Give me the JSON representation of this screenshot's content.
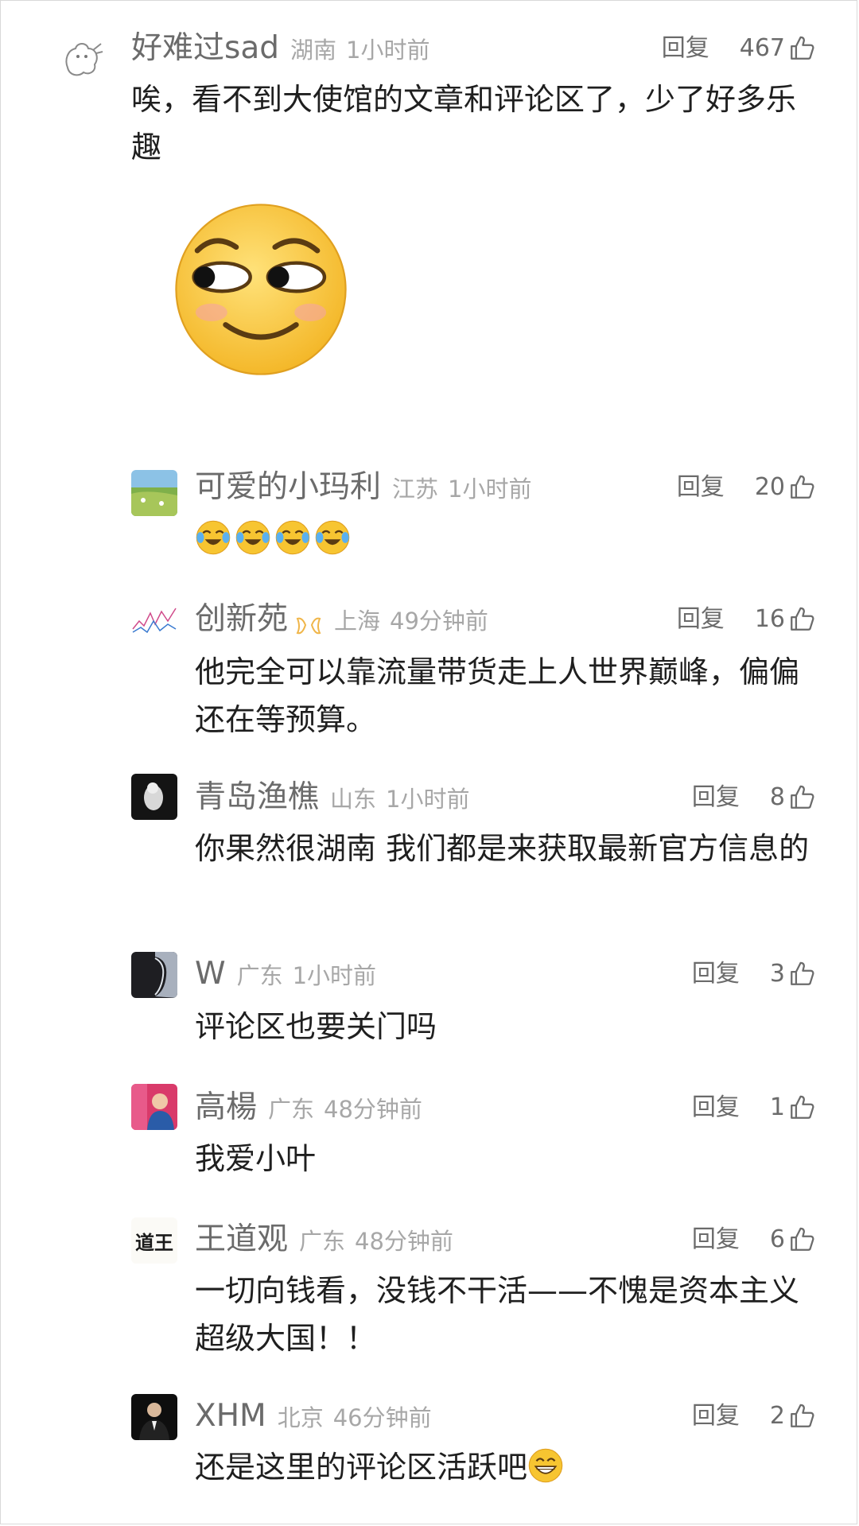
{
  "reply_label": "回复",
  "comments": [
    {
      "username": "好难过sad",
      "location": "湖南",
      "time": "1小时前",
      "likes": "467",
      "text": "唉，看不到大使馆的文章和评论区了，少了好多乐趣",
      "sticker": "smirk-emoji"
    },
    {
      "username": "可爱的小玛利",
      "location": "江苏",
      "time": "1小时前",
      "likes": "20",
      "text": "",
      "emojis": [
        "laugh-cry-emoji",
        "laugh-cry-emoji",
        "laugh-cry-emoji",
        "laugh-cry-emoji"
      ]
    },
    {
      "username": "创新苑",
      "location": "上海",
      "time": "49分钟前",
      "likes": "16",
      "text": "他完全可以靠流量带货走上人世界巅峰，偏偏还在等预算。",
      "badge": "vip-badge"
    },
    {
      "username": "青岛渔樵",
      "location": "山东",
      "time": "1小时前",
      "likes": "8",
      "text": "你果然很湖南 我们都是来获取最新官方信息的"
    },
    {
      "username": "W",
      "location": "广东",
      "time": "1小时前",
      "likes": "3",
      "text": "评论区也要关门吗"
    },
    {
      "username": "高楊",
      "location": "广东",
      "time": "48分钟前",
      "likes": "1",
      "text": "我爱小叶"
    },
    {
      "username": "王道观",
      "location": "广东",
      "time": "48分钟前",
      "likes": "6",
      "text": "一切向钱看，没钱不干活——不愧是资本主义超级大国！！",
      "avatar_text": "道王"
    },
    {
      "username": "XHM",
      "location": "北京",
      "time": "46分钟前",
      "likes": "2",
      "text": "还是这里的评论区活跃吧",
      "trailing_emoji": "grin-emoji"
    }
  ],
  "colors": {
    "username": "#6b6b6b",
    "meta": "#a7a7a7",
    "text": "#1f1f1f",
    "emoji_yellow": "#f7c531"
  }
}
